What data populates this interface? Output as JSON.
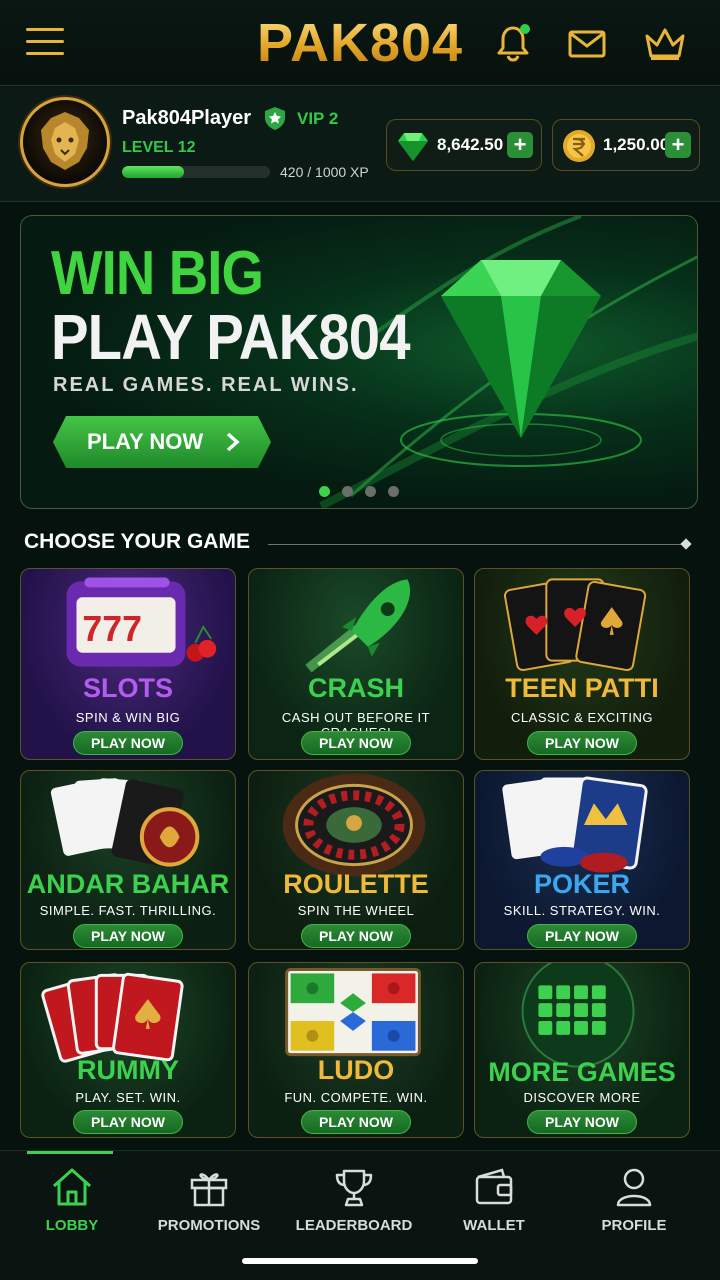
{
  "header": {
    "logo": "PAK804",
    "menu_icon": "hamburger-icon",
    "icons": [
      "bell-icon",
      "mail-icon",
      "crown-icon"
    ]
  },
  "profile": {
    "username": "Pak804Player",
    "vip": "VIP 2",
    "level": "LEVEL 12",
    "xp_text": "420 / 1000 XP",
    "xp_progress": 0.42,
    "gems": "8,642.50",
    "coins": "1,250.00"
  },
  "banner": {
    "line1": "WIN BIG",
    "line2": "PLAY PAK804",
    "tagline": "REAL GAMES. REAL WINS.",
    "cta": "PLAY NOW",
    "slides": 4,
    "active_slide": 1
  },
  "section_title": "CHOOSE YOUR GAME",
  "games": [
    {
      "title": "SLOTS",
      "sub": "SPIN & WIN BIG",
      "btn": "PLAY NOW",
      "color": "#b45cf0"
    },
    {
      "title": "CRASH",
      "sub": "CASH OUT BEFORE IT CRASHES!",
      "btn": "PLAY NOW",
      "color": "#3ed04f"
    },
    {
      "title": "TEEN PATTI",
      "sub": "CLASSIC & EXCITING",
      "btn": "PLAY NOW",
      "color": "#f0b93a"
    },
    {
      "title": "ANDAR BAHAR",
      "sub": "SIMPLE. FAST. THRILLING.",
      "btn": "PLAY NOW",
      "color": "#3ed04f"
    },
    {
      "title": "ROULETTE",
      "sub": "SPIN THE WHEEL",
      "btn": "PLAY NOW",
      "color": "#f0b93a"
    },
    {
      "title": "POKER",
      "sub": "SKILL. STRATEGY. WIN.",
      "btn": "PLAY NOW",
      "color": "#3aa8f0"
    },
    {
      "title": "RUMMY",
      "sub": "PLAY. SET. WIN.",
      "btn": "PLAY NOW",
      "color": "#3ed04f"
    },
    {
      "title": "LUDO",
      "sub": "FUN. COMPETE. WIN.",
      "btn": "PLAY NOW",
      "color": "#f0b93a"
    },
    {
      "title": "MORE GAMES",
      "sub": "DISCOVER MORE",
      "btn": "PLAY NOW",
      "color": "#3ed04f"
    }
  ],
  "nav": [
    {
      "label": "LOBBY",
      "icon": "home-icon",
      "active": true
    },
    {
      "label": "PROMOTIONS",
      "icon": "gift-icon"
    },
    {
      "label": "LEADERBOARD",
      "icon": "trophy-icon"
    },
    {
      "label": "WALLET",
      "icon": "wallet-icon"
    },
    {
      "label": "PROFILE",
      "icon": "user-icon"
    }
  ]
}
